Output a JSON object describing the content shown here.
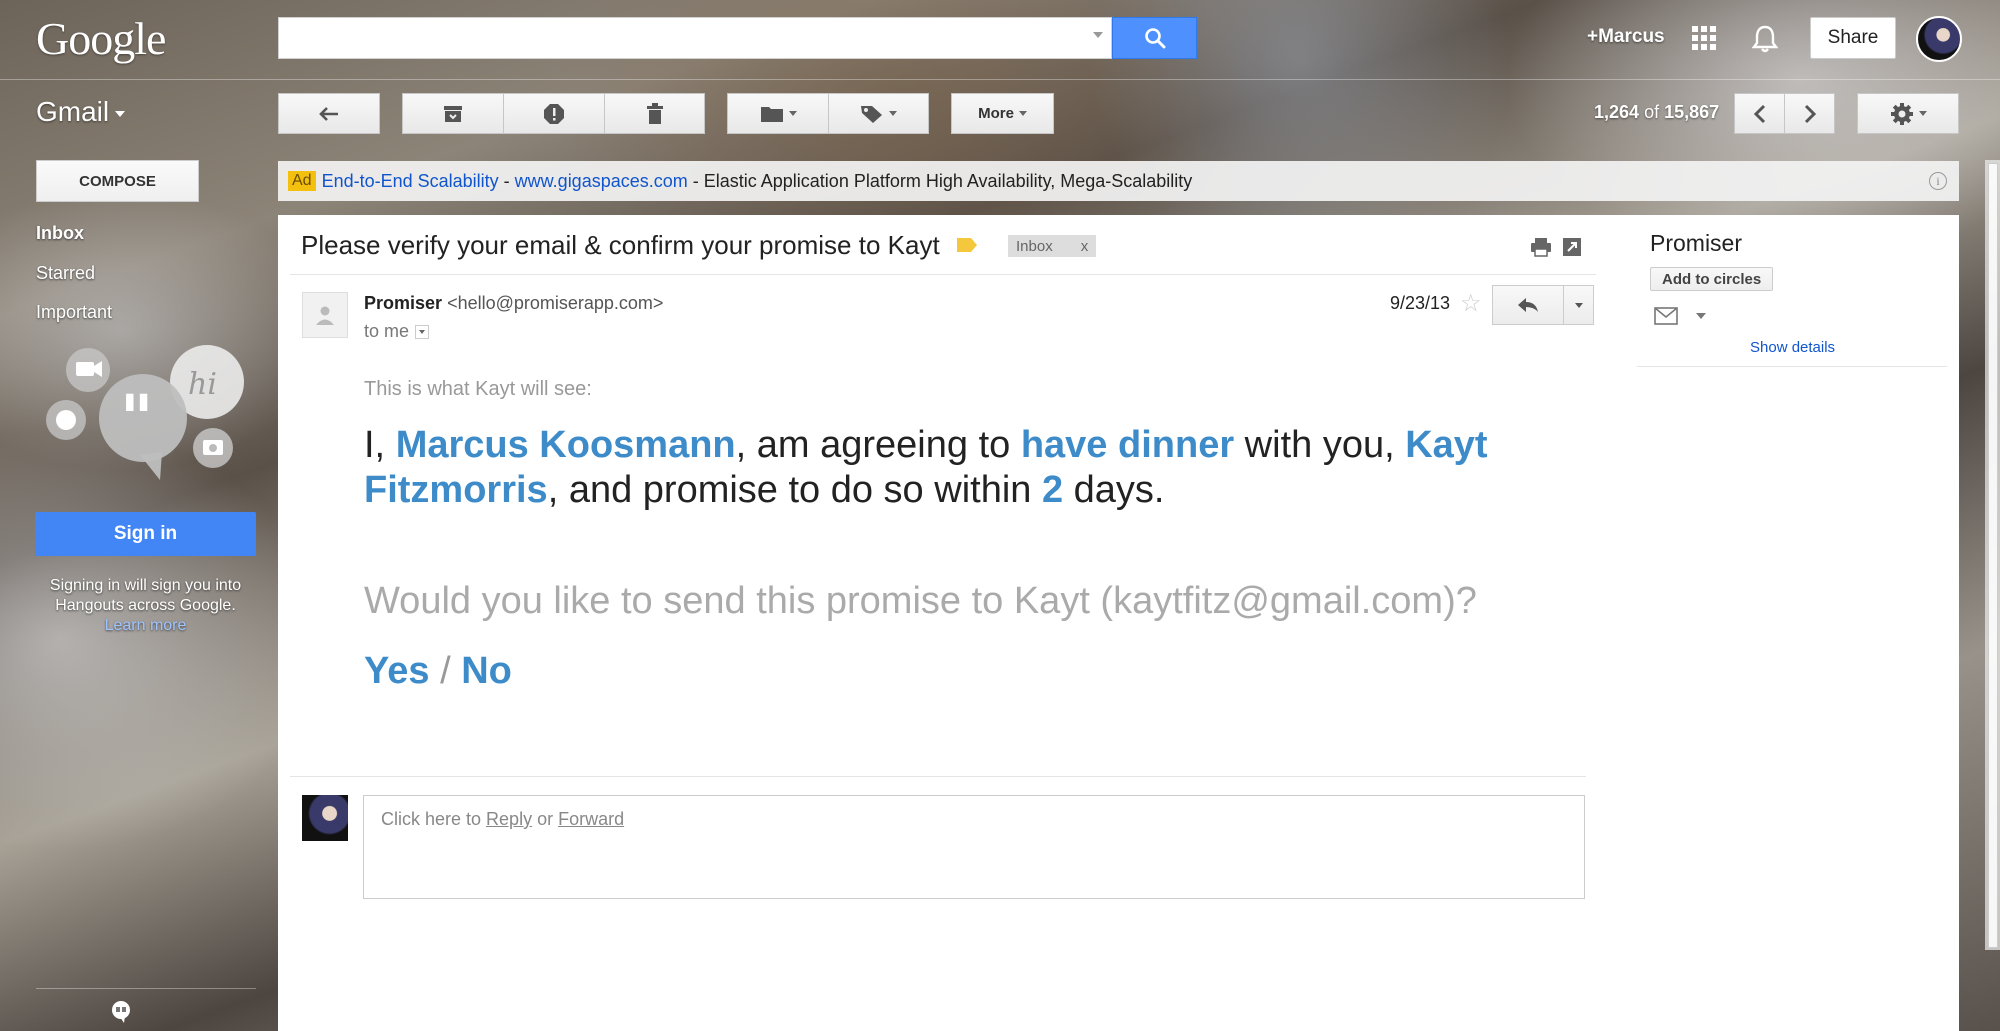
{
  "header": {
    "logo": "Google",
    "search_placeholder": "",
    "user_link": "+Marcus",
    "share_label": "Share"
  },
  "toolbar": {
    "app_name": "Gmail",
    "more_label": "More",
    "count_current": "1,264",
    "count_of": "of",
    "count_total": "15,867"
  },
  "sidebar": {
    "compose_label": "COMPOSE",
    "items": [
      {
        "label": "Inbox",
        "bold": true
      },
      {
        "label": "Starred",
        "bold": false
      },
      {
        "label": "Important",
        "bold": false
      }
    ],
    "signin_label": "Sign in",
    "signin_note": "Signing in will sign you into Hangouts across Google.",
    "learn_more": "Learn more"
  },
  "ad": {
    "badge": "Ad",
    "title": "End-to-End Scalability",
    "sep1": " - ",
    "url": "www.gigaspaces.com",
    "description": " - Elastic Application Platform High Availability, Mega-Scalability",
    "info": "i"
  },
  "message": {
    "subject": "Please verify your email & confirm your promise to Kayt",
    "label": "Inbox",
    "label_remove": "x",
    "sender_name": "Promiser",
    "sender_email": "<hello@promiserapp.com>",
    "recipient": "to me",
    "date": "9/23/13",
    "lead": "This is what Kayt will see:",
    "promise": {
      "p1": "I, ",
      "name": "Marcus Koosmann",
      "p2": ", am agreeing to ",
      "action": "have dinner",
      "p3": " with you, ",
      "recipient": "Kayt Fitzmorris",
      "p4": ", and promise to do so within ",
      "days": "2",
      "p5": " days."
    },
    "question": "Would you like to send this promise to Kayt (kaytfitz@gmail.com)?",
    "yes": "Yes",
    "slash": " / ",
    "no": "No",
    "reply_prefix": "Click here to ",
    "reply_link": "Reply",
    "reply_or": " or ",
    "forward_link": "Forward"
  },
  "contact_panel": {
    "name": "Promiser",
    "add_circles": "Add to circles",
    "show_details": "Show details"
  },
  "colors": {
    "accent_blue": "#3d8bc9",
    "link_blue": "#1155cc",
    "search_blue": "#4d90fe",
    "signin_blue": "#4285f4",
    "ad_badge": "#f3c010"
  }
}
